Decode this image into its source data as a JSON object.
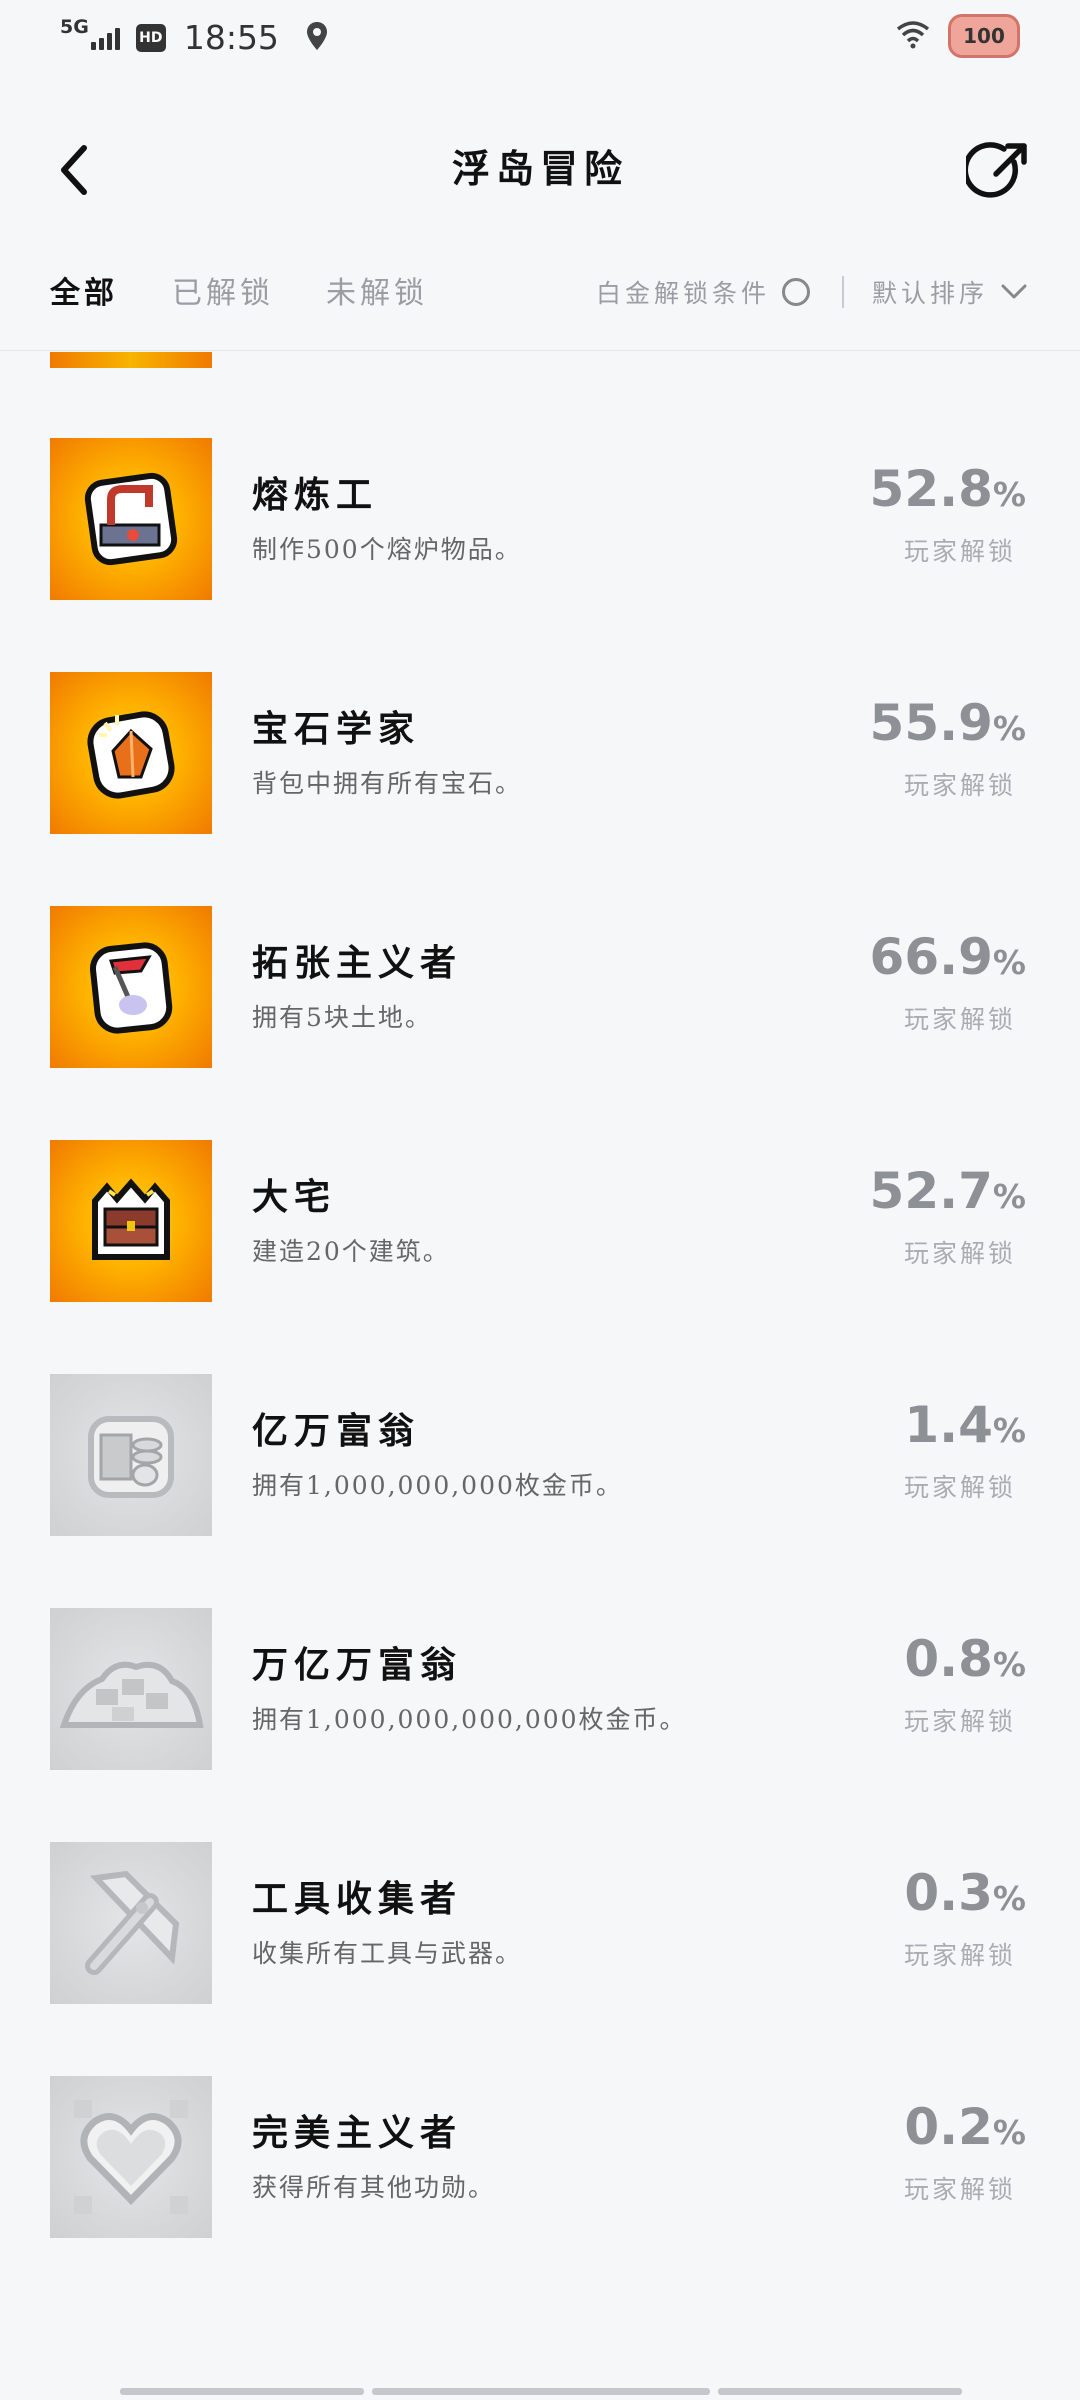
{
  "status_bar": {
    "network": "5G",
    "hd": "HD",
    "time": "18:55",
    "battery": "100"
  },
  "header": {
    "title": "浮岛冒险"
  },
  "tabs": {
    "all": "全部",
    "unlocked": "已解锁",
    "locked": "未解锁",
    "filter_label": "白金解锁条件",
    "sort_label": "默认排序"
  },
  "achievements": [
    {
      "title": "熔炼工",
      "description": "制作500个熔炉物品。",
      "percent": "52.8",
      "percent_symbol": "%",
      "sub": "玩家解锁",
      "icon": "furnace-icon",
      "unlocked": true
    },
    {
      "title": "宝石学家",
      "description": "背包中拥有所有宝石。",
      "percent": "55.9",
      "percent_symbol": "%",
      "sub": "玩家解锁",
      "icon": "gem-icon",
      "unlocked": true
    },
    {
      "title": "拓张主义者",
      "description": "拥有5块土地。",
      "percent": "66.9",
      "percent_symbol": "%",
      "sub": "玩家解锁",
      "icon": "flag-icon",
      "unlocked": true
    },
    {
      "title": "大宅",
      "description": "建造20个建筑。",
      "percent": "52.7",
      "percent_symbol": "%",
      "sub": "玩家解锁",
      "icon": "treasure-chest-icon",
      "unlocked": true
    },
    {
      "title": "亿万富翁",
      "description": "拥有1,000,000,000枚金币。",
      "percent": "1.4",
      "percent_symbol": "%",
      "sub": "玩家解锁",
      "icon": "coin-stack-icon",
      "unlocked": false
    },
    {
      "title": "万亿万富翁",
      "description": "拥有1,000,000,000,000枚金币。",
      "percent": "0.8",
      "percent_symbol": "%",
      "sub": "玩家解锁",
      "icon": "coin-pile-icon",
      "unlocked": false
    },
    {
      "title": "工具收集者",
      "description": "收集所有工具与武器。",
      "percent": "0.3",
      "percent_symbol": "%",
      "sub": "玩家解锁",
      "icon": "pickaxe-icon",
      "unlocked": false
    },
    {
      "title": "完美主义者",
      "description": "获得所有其他功勋。",
      "percent": "0.2",
      "percent_symbol": "%",
      "sub": "玩家解锁",
      "icon": "heart-icon",
      "unlocked": false
    }
  ],
  "colors": {
    "unlocked_bg": "#f7a600",
    "locked_bg": "#d7d8da",
    "percent_text": "#8d9095"
  }
}
